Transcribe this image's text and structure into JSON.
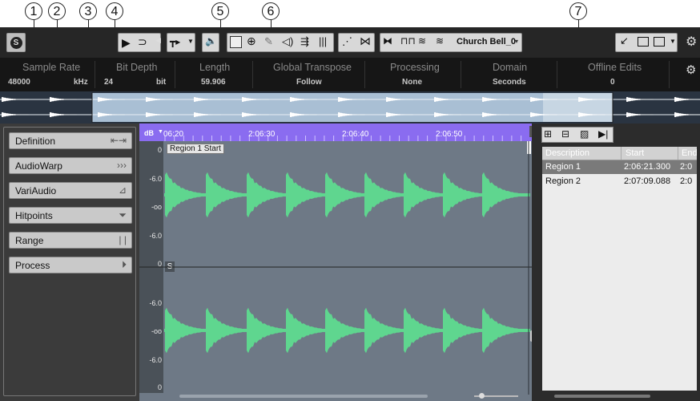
{
  "callouts": [
    "1",
    "2",
    "3",
    "4",
    "5",
    "6",
    "7"
  ],
  "toolbar": {
    "solo_label": "S",
    "audio_selector": "Church Bell_0"
  },
  "info": {
    "columns": [
      {
        "label": "Sample Rate",
        "value": "48000",
        "unit": "kHz"
      },
      {
        "label": "Bit Depth",
        "value": "24",
        "unit": "bit"
      },
      {
        "label": "Length",
        "value": "59.906",
        "unit": ""
      },
      {
        "label": "Global Transpose",
        "value": "Follow",
        "unit": ""
      },
      {
        "label": "Processing",
        "value": "None",
        "unit": ""
      },
      {
        "label": "Domain",
        "value": "Seconds",
        "unit": ""
      },
      {
        "label": "Offline Edits",
        "value": "0",
        "unit": ""
      }
    ]
  },
  "left_tabs": [
    {
      "label": "Definition",
      "icon": "stretch-icon"
    },
    {
      "label": "AudioWarp",
      "icon": "warp-arrows-icon"
    },
    {
      "label": "VariAudio",
      "icon": "variaudio-icon"
    },
    {
      "label": "Hitpoints",
      "icon": "hitpoints-funnel-icon"
    },
    {
      "label": "Range",
      "icon": "range-bars-icon"
    },
    {
      "label": "Process",
      "icon": "play-circle-icon"
    }
  ],
  "ruler": {
    "unit_label": "dB",
    "ticks": [
      "06:20",
      "2:06:30",
      "2:06:40",
      "2:06:50"
    ],
    "region_marker": "Region 1 Start"
  },
  "db_scale_top": [
    "0",
    "-6.0",
    "-oo",
    "-6.0",
    "0"
  ],
  "db_scale_bottom": [
    "-6.0",
    "-oo",
    "-6.0",
    "0"
  ],
  "channel_marker": "S",
  "regions_table": {
    "headers": [
      "Description",
      "Start",
      "End"
    ],
    "rows": [
      {
        "description": "Region 1",
        "start": "2:06:21.300",
        "end": "2:0"
      },
      {
        "description": "Region 2",
        "start": "2:07:09.088",
        "end": "2:0"
      }
    ]
  },
  "colors": {
    "waveform": "#5fd68f",
    "ruler": "#8a6cf0",
    "editor_bg": "#6e7986",
    "toolbar_bg": "#262626"
  }
}
